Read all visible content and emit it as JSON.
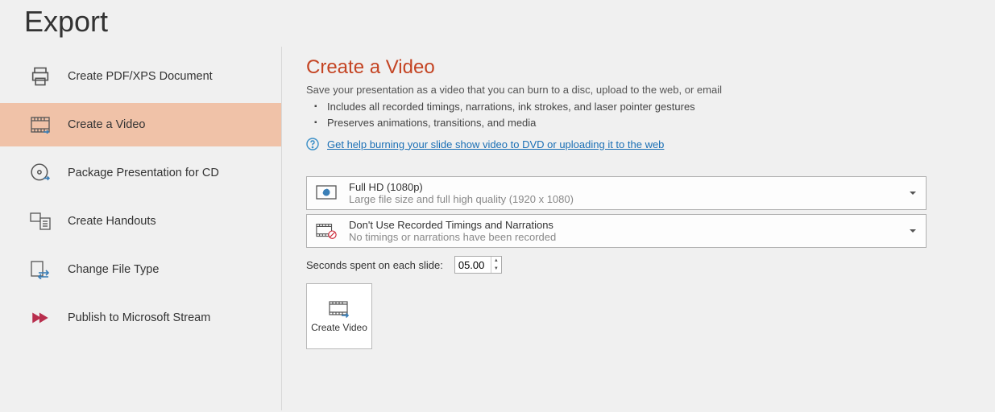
{
  "title": "Export",
  "sidebar": {
    "items": [
      {
        "label": "Create PDF/XPS Document"
      },
      {
        "label": "Create a Video"
      },
      {
        "label": "Package Presentation for CD"
      },
      {
        "label": "Create Handouts"
      },
      {
        "label": "Change File Type"
      },
      {
        "label": "Publish to Microsoft Stream"
      }
    ]
  },
  "main": {
    "heading": "Create a Video",
    "desc": "Save your presentation as a video that you can burn to a disc, upload to the web, or email",
    "bullets": [
      "Includes all recorded timings, narrations, ink strokes, and laser pointer gestures",
      "Preserves animations, transitions, and media"
    ],
    "help_link": "Get help burning your slide show video to DVD or uploading it to the web",
    "quality": {
      "title": "Full HD (1080p)",
      "sub": "Large file size and full high quality (1920 x 1080)"
    },
    "timings": {
      "title": "Don't Use Recorded Timings and Narrations",
      "sub": "No timings or narrations have been recorded"
    },
    "seconds_label": "Seconds spent on each slide:",
    "seconds_value": "05.00",
    "create_button": "Create Video"
  }
}
